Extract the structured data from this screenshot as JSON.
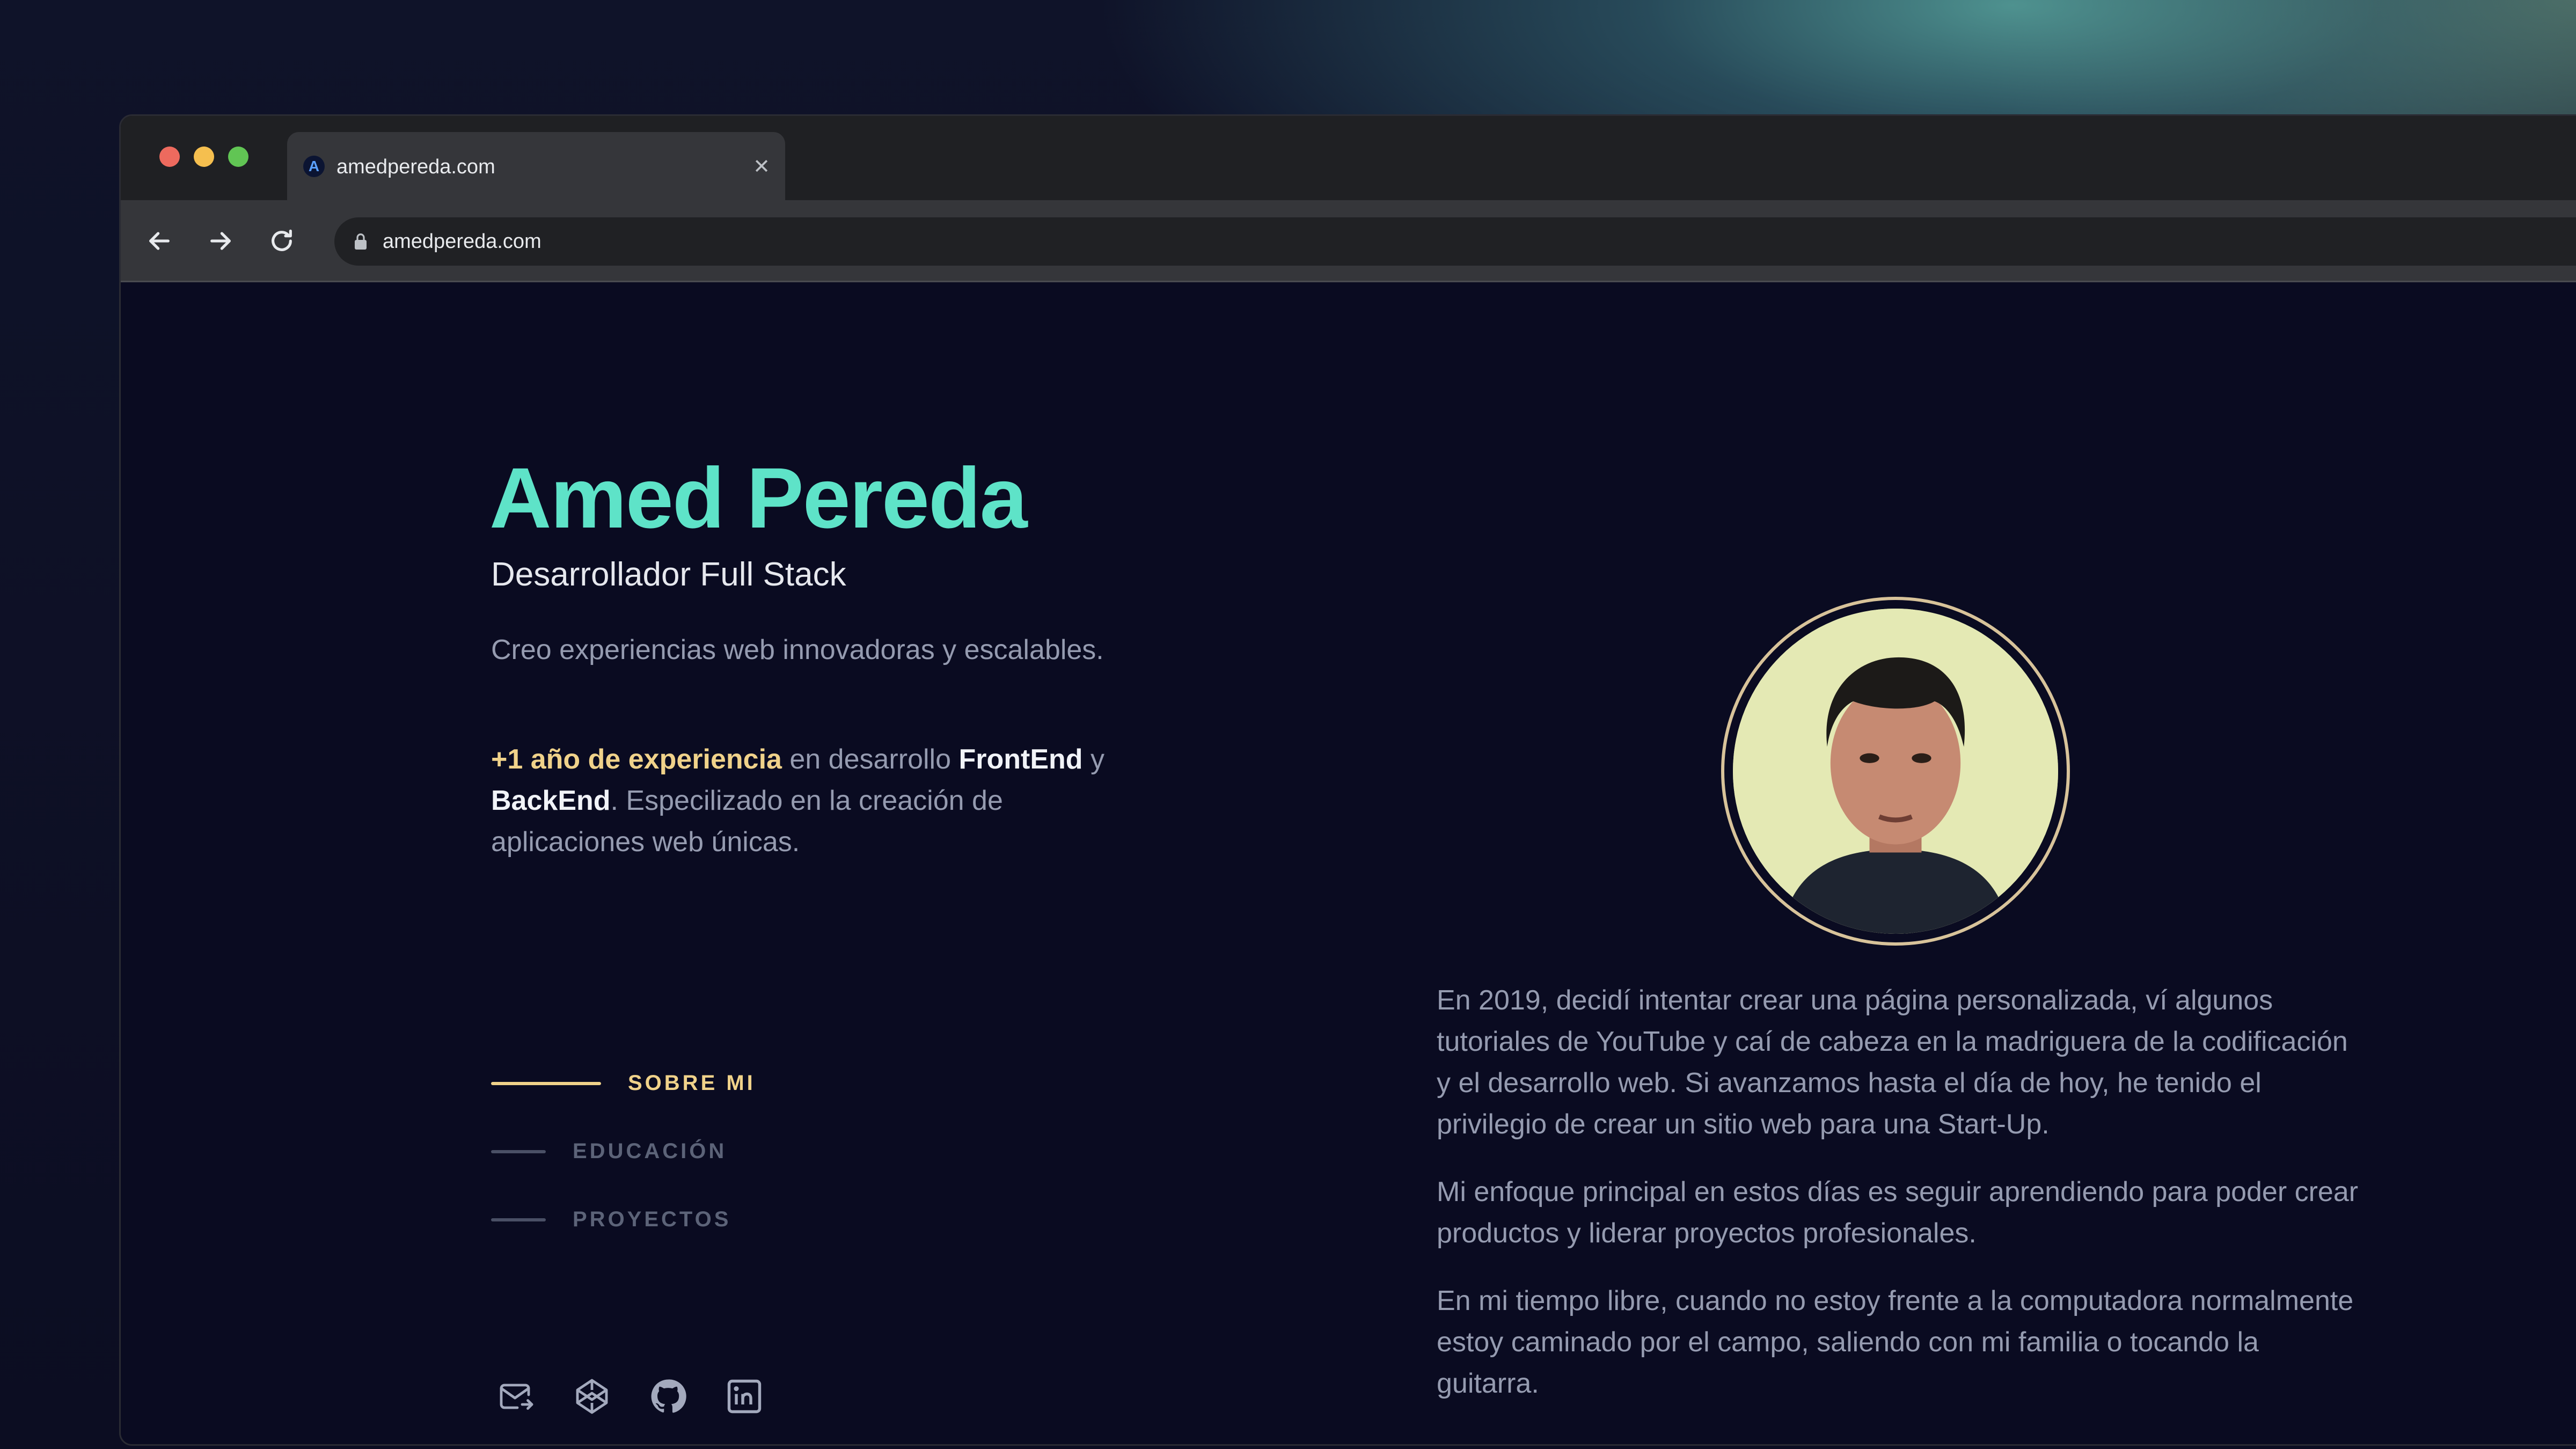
{
  "browser": {
    "tab_title": "amedpereda.com",
    "tab_favicon_letter": "A",
    "url": "amedpereda.com",
    "icons": {
      "back": "back-arrow-icon",
      "forward": "forward-arrow-icon",
      "reload": "reload-icon",
      "lock": "lock-icon",
      "close": "close-icon",
      "share": "share-icon"
    }
  },
  "hero": {
    "name": "Amed Pereda",
    "role": "Desarrollador Full Stack",
    "tagline": "Creo experiencias web innovadoras y escalables.",
    "experience": {
      "highlight": "+1 año de experiencia",
      "t1": " en desarrollo ",
      "frontend": "FrontEnd",
      "t2": " y ",
      "backend": "BackEnd",
      "t3": ". Especilizado en la creación de aplicaciones web únicas."
    }
  },
  "nav": {
    "items": [
      {
        "label": "SOBRE MI",
        "active": true
      },
      {
        "label": "EDUCACIÓN",
        "active": false
      },
      {
        "label": "PROYECTOS",
        "active": false
      }
    ]
  },
  "socials": [
    "mail-icon",
    "codepen-icon",
    "github-icon",
    "linkedin-icon"
  ],
  "about": {
    "paragraphs": [
      "En 2019, decidí intentar crear una página personalizada, ví algunos tutoriales de YouTube y caí de cabeza en la madriguera de la codificación y el desarrollo web. Si avanzamos hasta el día de hoy, he tenido el privilegio de crear un sitio web para una Start-Up.",
      "Mi enfoque principal en estos días es seguir aprendiendo para poder crear productos y liderar proyectos profesionales.",
      "En mi tiempo libre, cuando no estoy frente a la computadora normalmente estoy caminado por el campo, saliendo con mi familia o tocando la guitarra."
    ]
  },
  "colors": {
    "background": "#0a0b21",
    "name_accent": "#5ee3c8",
    "gold_accent": "#f0d28a",
    "body_text": "#959bb0"
  }
}
